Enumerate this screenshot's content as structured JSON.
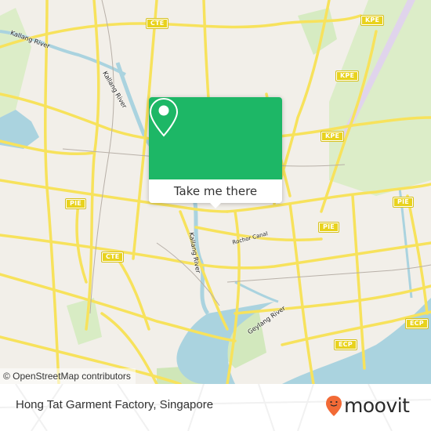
{
  "map": {
    "highway_shields": [
      {
        "label": "CTE",
        "id": "cte-north"
      },
      {
        "label": "KPE",
        "id": "kpe-north"
      },
      {
        "label": "KPE",
        "id": "kpe-middle"
      },
      {
        "label": "KPE",
        "id": "kpe-south"
      },
      {
        "label": "PIE",
        "id": "pie-west"
      },
      {
        "label": "PIE",
        "id": "pie-center"
      },
      {
        "label": "PIE",
        "id": "pie-east"
      },
      {
        "label": "CTE",
        "id": "cte-south"
      },
      {
        "label": "ECP",
        "id": "ecp-center"
      },
      {
        "label": "ECP",
        "id": "ecp-east"
      }
    ],
    "water_labels": [
      {
        "label": "Kallang River"
      },
      {
        "label": "Kallang River"
      },
      {
        "label": "Kallang River"
      },
      {
        "label": "Geylang River"
      },
      {
        "label": "Rochor Canal"
      }
    ],
    "attribution": "© OpenStreetMap contributors",
    "colors": {
      "land": "#f2efe9",
      "road": "#f7e25c",
      "water": "#aad3df",
      "park": "#d8ecc4",
      "runway": "#e0d4ec"
    }
  },
  "popup": {
    "icon": "location-pin-icon",
    "button_label": "Take me there",
    "color": "#1db766"
  },
  "footer": {
    "place_name": "Hong Tat Garment Factory, Singapore",
    "logo_text": "moovit",
    "logo_color": "#f26a36"
  }
}
